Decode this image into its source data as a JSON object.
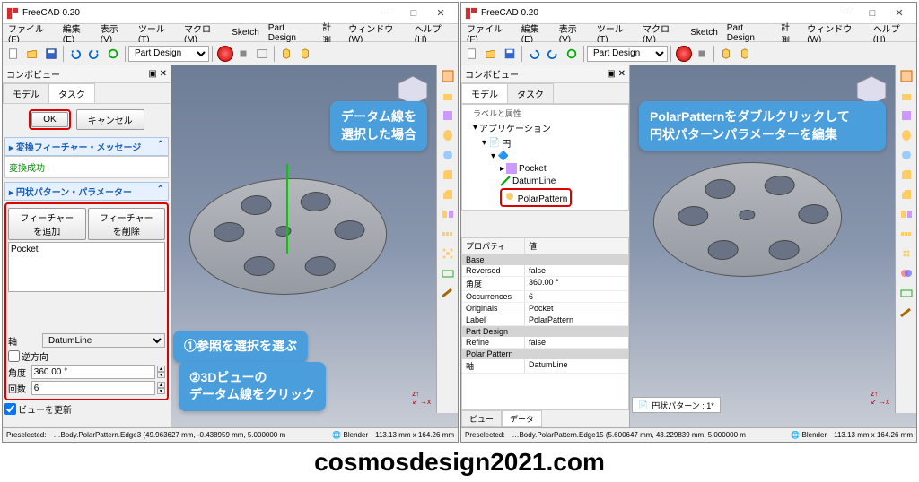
{
  "app_title": "FreeCAD 0.20",
  "menu": [
    "ファイル(F)",
    "編集(E)",
    "表示(V)",
    "ツール(T)",
    "マクロ(M)",
    "Sketch",
    "Part Design",
    "計測",
    "ウィンドウ(W)",
    "ヘルプ(H)"
  ],
  "workbench": "Part Design",
  "combo_view": {
    "title": "コンボビュー",
    "tabs": [
      "モデル",
      "タスク"
    ],
    "active_tab_left": 1,
    "active_tab_right": 0
  },
  "task_left": {
    "ok": "OK",
    "cancel": "キャンセル",
    "msg_hdr": "変換フィーチャー・メッセージ",
    "msg_body": "変換成功",
    "param_hdr": "円状パターン・パラメーター",
    "add_feature": "フィーチャーを追加",
    "remove_feature": "フィーチャーを削除",
    "feature_list": "Pocket",
    "axis_label": "軸",
    "axis_value": "DatumLine",
    "reverse": "逆方向",
    "angle_label": "角度",
    "angle_value": "360.00 °",
    "count_label": "回数",
    "count_value": "6",
    "update_view": "ビューを更新"
  },
  "tree_right": {
    "labels_attrs": "ラベルと属性",
    "application": "アプリケーション",
    "body_label": "円",
    "item_pocket": "Pocket",
    "item_datum": "DatumLine",
    "item_polar": "PolarPattern"
  },
  "props": {
    "hdr_prop": "プロパティ",
    "hdr_val": "値",
    "grp_base": "Base",
    "reversed_k": "Reversed",
    "reversed_v": "false",
    "angle_k": "角度",
    "angle_v": "360.00 °",
    "occ_k": "Occurrences",
    "occ_v": "6",
    "orig_k": "Originals",
    "orig_v": "Pocket",
    "label_k": "Label",
    "label_v": "PolarPattern",
    "grp_pd": "Part Design",
    "refine_k": "Refine",
    "refine_v": "false",
    "grp_pp": "Polar Pattern",
    "axis_k": "軸",
    "axis_v": "DatumLine"
  },
  "callouts": {
    "c1a": "データム線を",
    "c1b": "選択した場合",
    "c2": "①参照を選択を選ぶ",
    "c3a": "②3Dビューの",
    "c3b": "データム線をクリック",
    "c4a": "PolarPatternをダブルクリックして",
    "c4b": "円状パターンパラメーターを編集"
  },
  "bottom_tabs": {
    "view": "ビュー",
    "data": "データ"
  },
  "status_left": {
    "preselected": "Preselected:",
    "path": "…Body.PolarPattern.Edge3 (49.963627 mm, -0.438959 mm, 5.000000 m",
    "nav": "Blender",
    "dims": "113.13 mm x 164.26 mm"
  },
  "status_right": {
    "preselected": "Preselected:",
    "path": "…Body.PolarPattern.Edge15 (5.600647 mm, 43.229839 mm, 5.000000 m",
    "nav": "Blender",
    "dims": "113.13 mm x 164.26 mm"
  },
  "doc_tab_right": "円状パターン : 1*",
  "footer": "cosmosdesign2021.com"
}
